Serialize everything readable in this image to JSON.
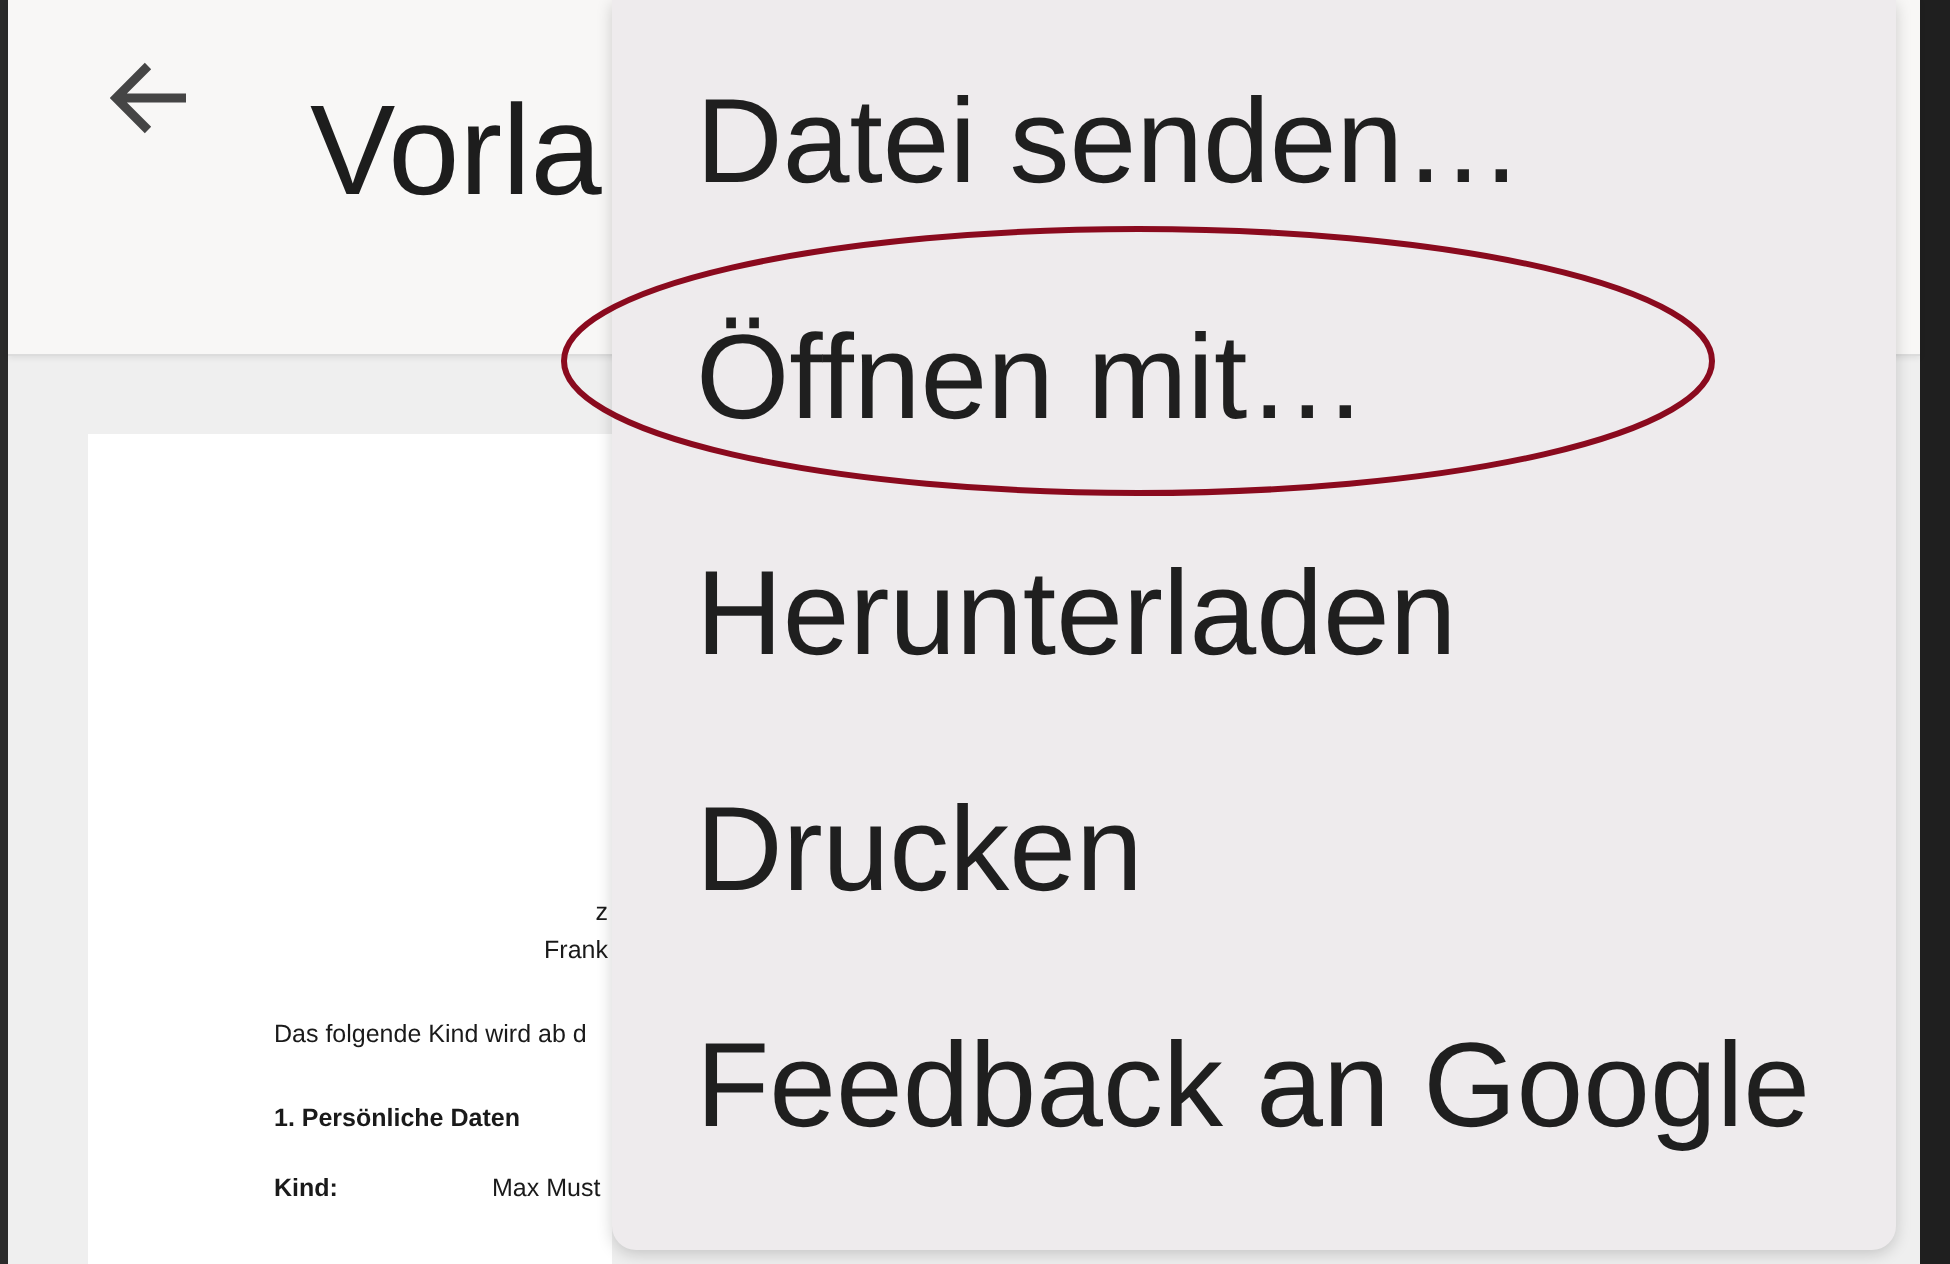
{
  "app_bar": {
    "title": "Vorla"
  },
  "document": {
    "lines": [
      {
        "kind": "center",
        "text": "z"
      },
      {
        "kind": "center",
        "text": "Frank"
      },
      {
        "kind": "body",
        "text": "Das folgende Kind wird ab d"
      },
      {
        "kind": "heading",
        "text": "1. Persönliche Daten"
      },
      {
        "kind": "field",
        "label": "Kind:",
        "value": "Max Must"
      }
    ]
  },
  "menu": {
    "items": [
      {
        "label": "Datei senden…",
        "highlighted": false
      },
      {
        "label": "Öffnen mit…",
        "highlighted": true
      },
      {
        "label": "Herunterladen",
        "highlighted": false
      },
      {
        "label": "Drucken",
        "highlighted": false
      },
      {
        "label": "Feedback an Google",
        "highlighted": false
      }
    ]
  }
}
